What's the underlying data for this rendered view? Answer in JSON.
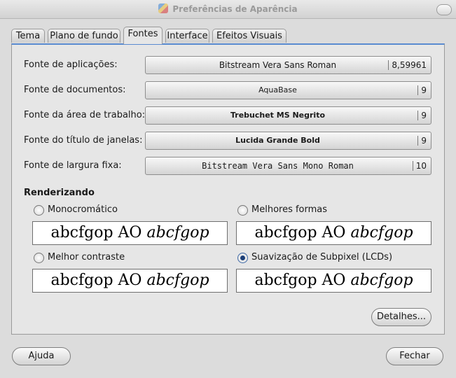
{
  "window": {
    "title": "Preferências de Aparência"
  },
  "tabs": [
    {
      "label": "Tema"
    },
    {
      "label": "Plano de fundo"
    },
    {
      "label": "Fontes",
      "active": true
    },
    {
      "label": "Interface"
    },
    {
      "label": "Efeitos Visuais"
    }
  ],
  "fonts": [
    {
      "label": "Fonte de aplicações:",
      "font": "Bitstream Vera Sans Roman",
      "size": "8,59961"
    },
    {
      "label": "Fonte de documentos:",
      "font": "AquaBase",
      "size": "9"
    },
    {
      "label": "Fonte da área de trabalho:",
      "font": "Trebuchet MS Negrito",
      "size": "9"
    },
    {
      "label": "Fonte do título de janelas:",
      "font": "Lucida Grande Bold",
      "size": "9"
    },
    {
      "label": "Fonte de largura fixa:",
      "font": "Bitstream Vera Sans Mono Roman",
      "size": "10"
    }
  ],
  "rendering": {
    "title": "Renderizando",
    "options": [
      {
        "label": "Monocromático",
        "selected": false
      },
      {
        "label": "Melhores formas",
        "selected": false
      },
      {
        "label": "Melhor contraste",
        "selected": false
      },
      {
        "label": "Suavização de Subpixel (LCDs)",
        "selected": true
      }
    ],
    "sample_regular": "abcfgop AO",
    "sample_italic": "abcfgop"
  },
  "buttons": {
    "details": "Detalhes...",
    "help": "Ajuda",
    "close": "Fechar"
  }
}
